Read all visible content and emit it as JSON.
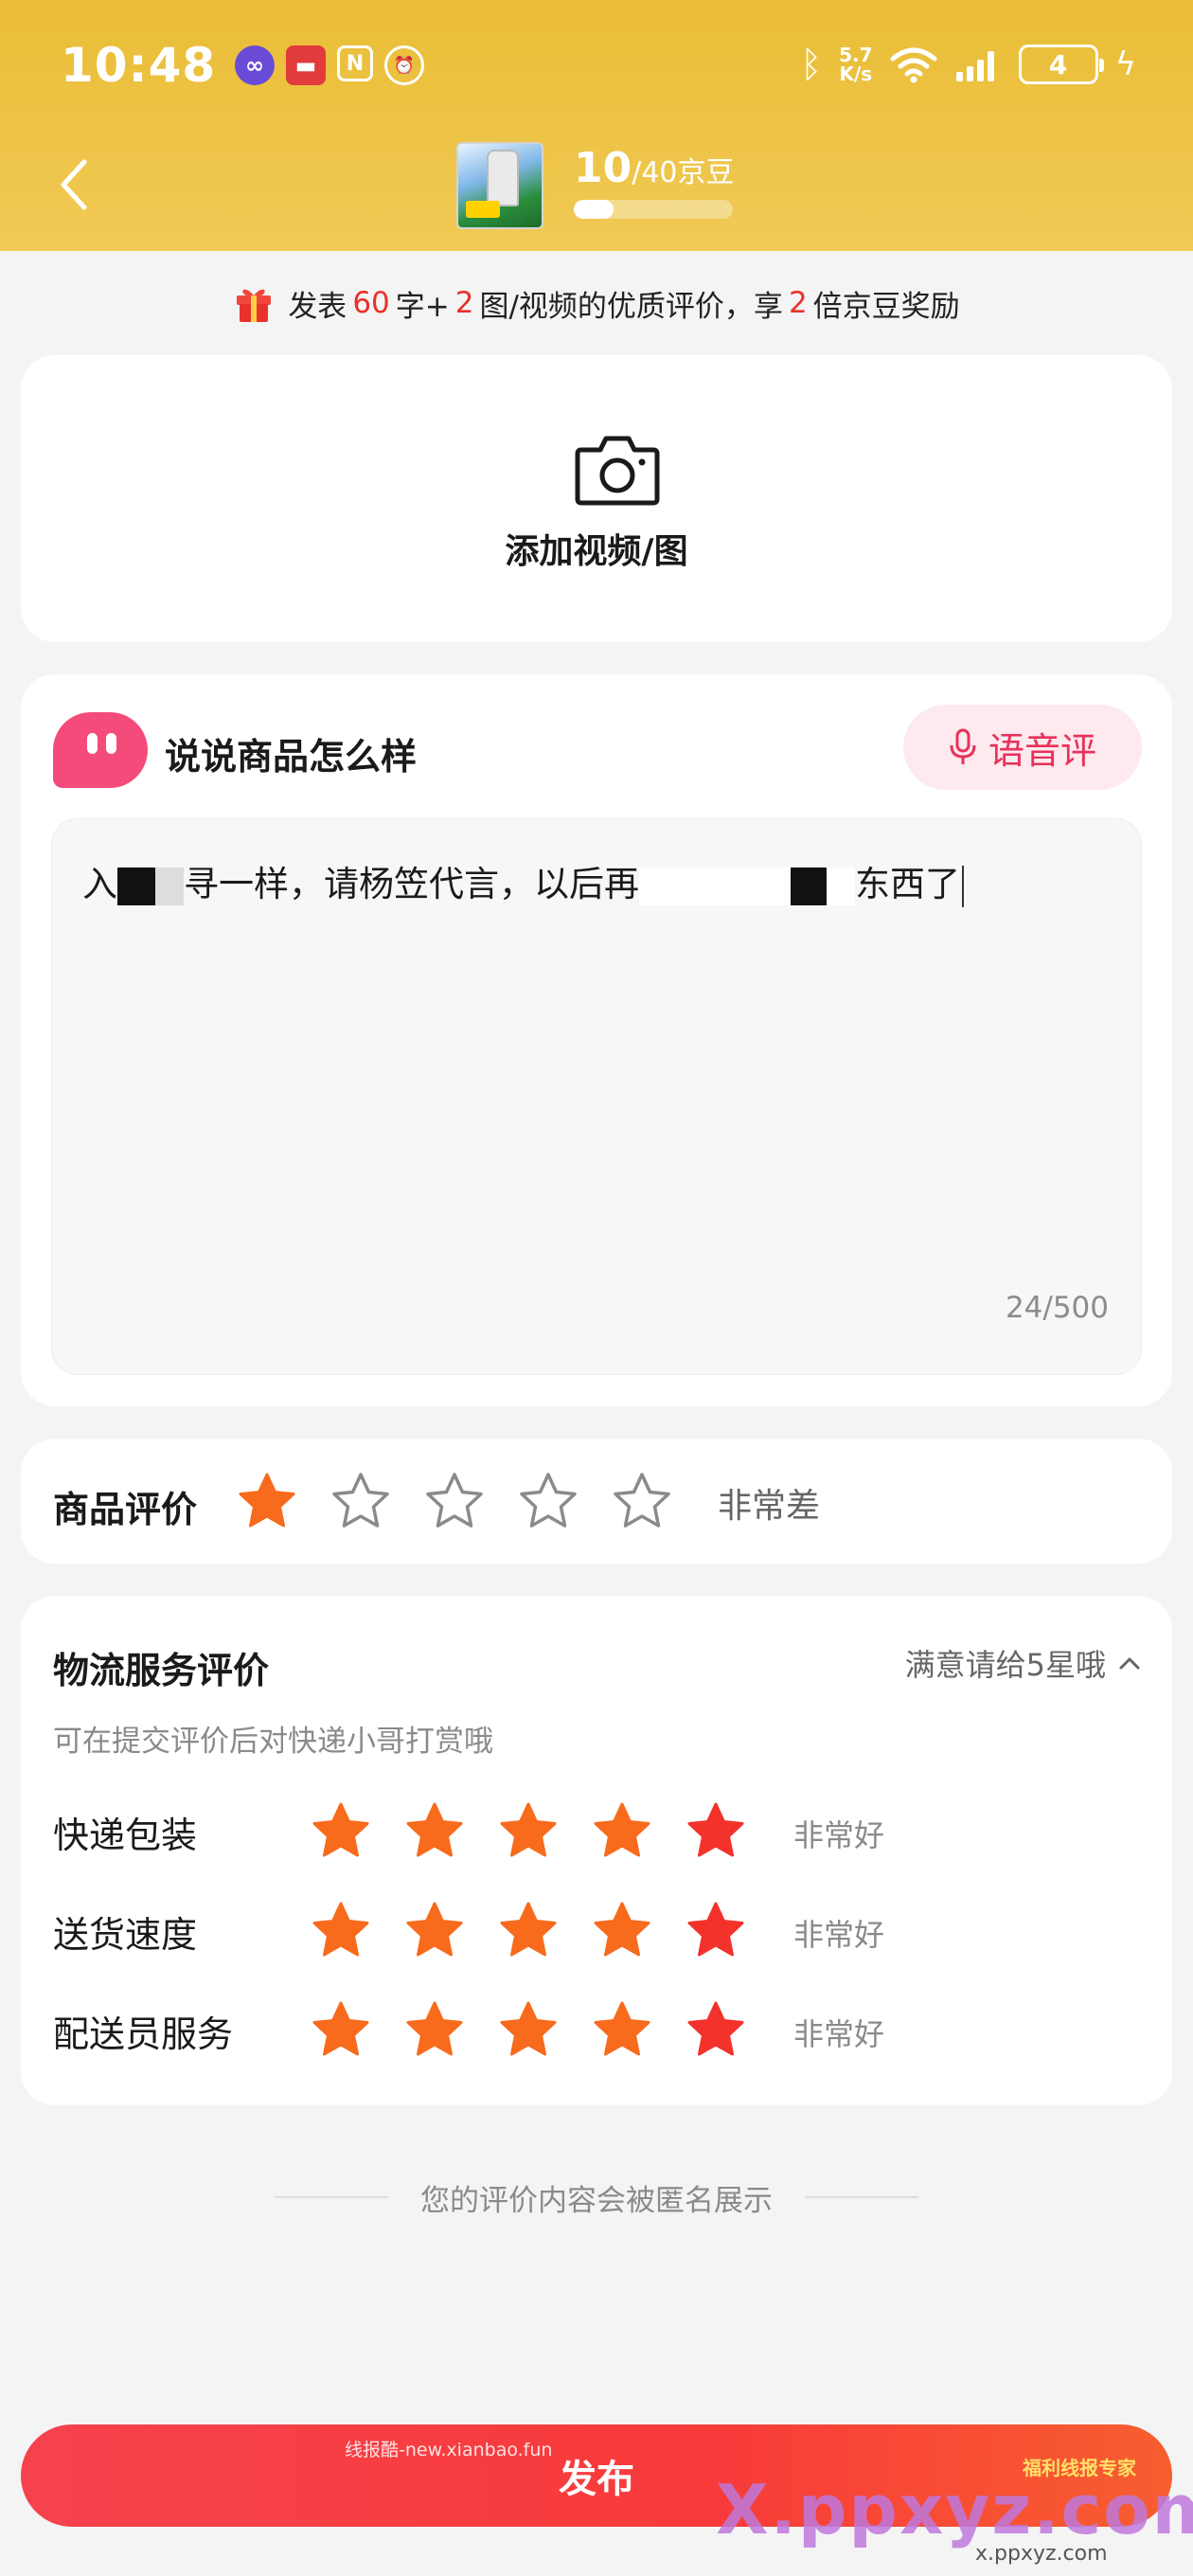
{
  "status_bar": {
    "time": "10:48",
    "network_speed_value": "5.7",
    "network_speed_unit": "K/s",
    "battery": "4"
  },
  "header": {
    "bean_earned": "10",
    "bean_total": "/40京豆",
    "bean_progress": 0.25
  },
  "reward_tip": {
    "prefix": "发表",
    "chars": "60",
    "mid1": "字+",
    "media": "2",
    "mid2": "图/视频的优质评价，享",
    "multiplier": "2",
    "suffix": "倍京豆奖励"
  },
  "upload": {
    "label": "添加视频/图"
  },
  "review": {
    "title": "说说商品怎么样",
    "voice_button": "语音评",
    "text_part1": "入",
    "text_part2": "寻一样，请杨笠代言，以后再",
    "text_part3": "东西了",
    "char_count": "24/500"
  },
  "product_rating": {
    "label": "商品评价",
    "value": 1,
    "max": 5,
    "description": "非常差"
  },
  "logistics": {
    "title": "物流服务评价",
    "hint": "满意请给5星哦",
    "subtitle": "可在提交评价后对快递小哥打赏哦",
    "rows": [
      {
        "label": "快递包装",
        "value": 5,
        "description": "非常好"
      },
      {
        "label": "送货速度",
        "value": 5,
        "description": "非常好"
      },
      {
        "label": "配送员服务",
        "value": 5,
        "description": "非常好"
      }
    ]
  },
  "anon_note": "您的评价内容会被匿名展示",
  "publish_button": "发布",
  "watermarks": {
    "top": "线报酷-new.xianbao.fun",
    "logo": "福利线报专家",
    "big": "X.ppxyz.com",
    "small": "x.ppxyz.com"
  },
  "colors": {
    "header_yellow": "#e9bd35",
    "accent_red": "#e8312a",
    "star_orange": "#f86a1c",
    "star_red": "#f2322b",
    "mascot_pink": "#f54b7b"
  }
}
